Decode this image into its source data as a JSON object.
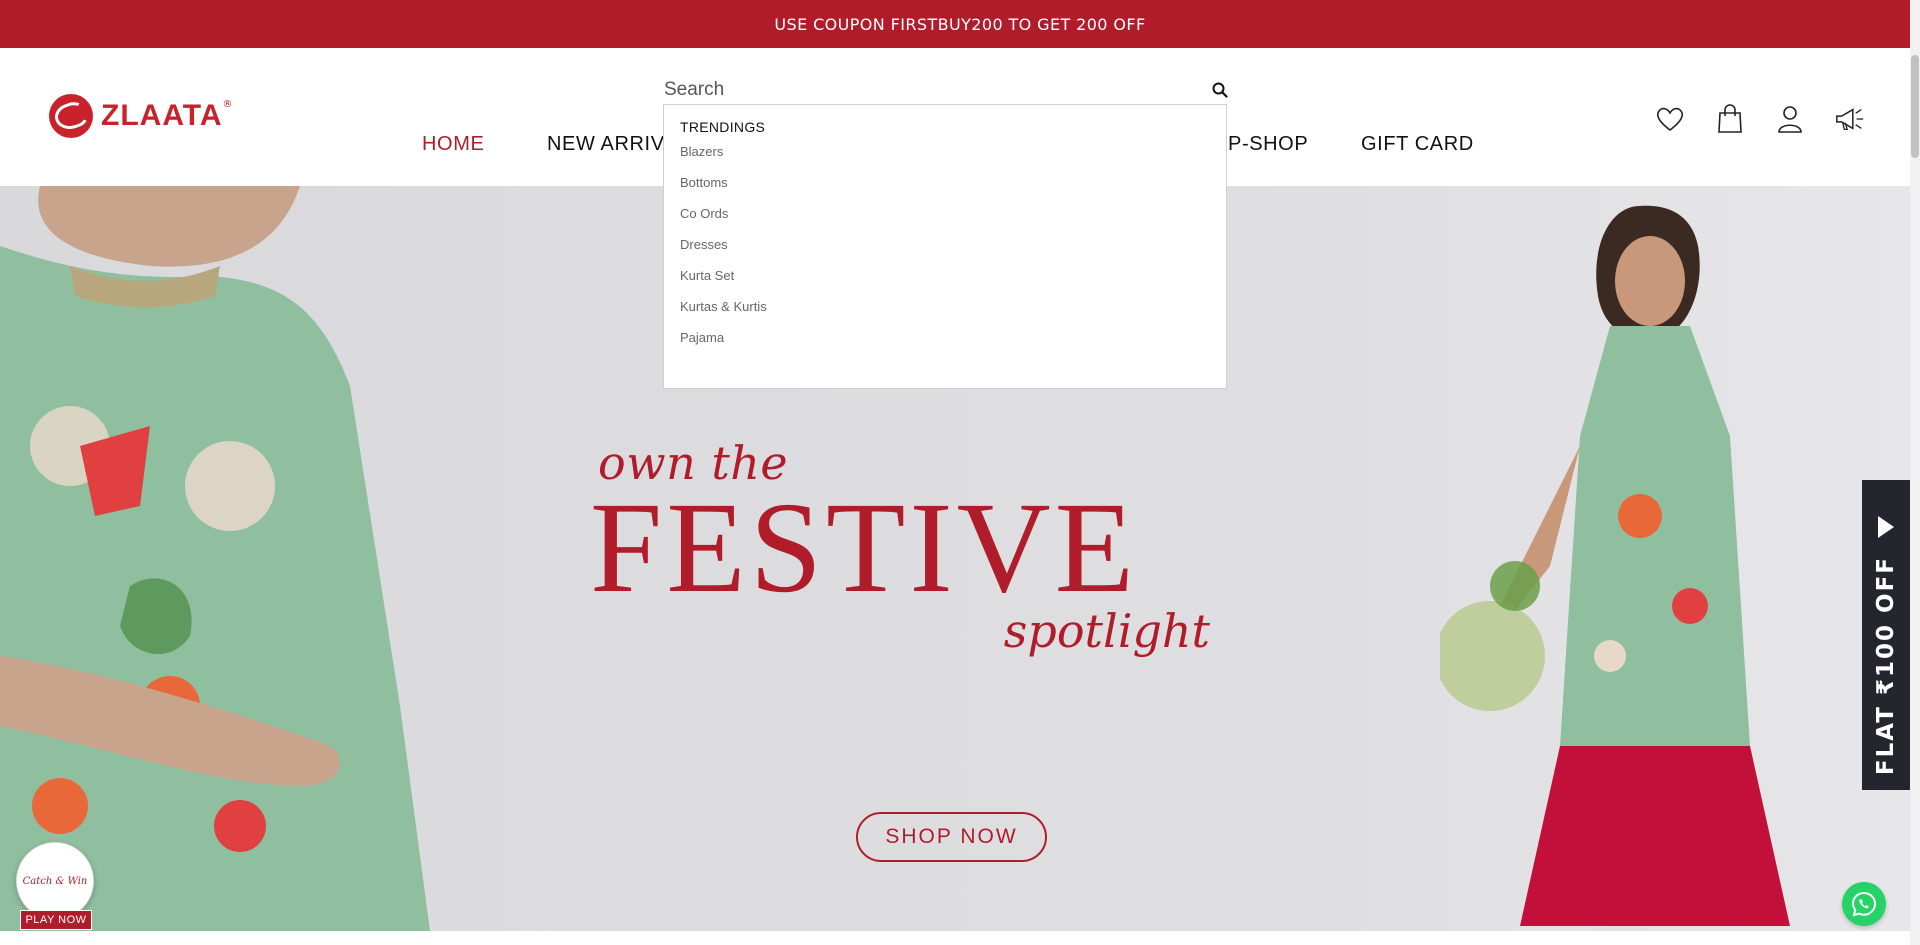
{
  "announcement": {
    "text": "USE COUPON FIRSTBUY200 TO GET 200 OFF"
  },
  "brand": {
    "name": "ZLAATA",
    "registered": "®"
  },
  "search": {
    "placeholder": "Search",
    "value": ""
  },
  "nav": [
    {
      "label": "HOME",
      "active": true
    },
    {
      "label": "NEW ARRIV",
      "active": false
    },
    {
      "label": "P-SHOP",
      "active": false
    },
    {
      "label": "GIFT CARD",
      "active": false
    }
  ],
  "header_icons": [
    "heart-icon",
    "shopping-bag-icon",
    "user-icon",
    "megaphone-icon"
  ],
  "dropdown": {
    "title": "TRENDINGS",
    "items": [
      "Blazers",
      "Bottoms",
      "Co Ords",
      "Dresses",
      "Kurta Set",
      "Kurtas & Kurtis",
      "Pajama"
    ]
  },
  "hero": {
    "line1": "own the",
    "line2": "FESTIVE",
    "line3": "spotlight",
    "cta": "SHOP NOW"
  },
  "side_tab": {
    "text": "FLAT ₹100 OFF"
  },
  "catch_win": {
    "label": "Catch & Win",
    "button": "PLAY NOW"
  },
  "colors": {
    "brand_red": "#b01c2a",
    "tab_dark": "#23262d",
    "whatsapp_green": "#25d366"
  }
}
